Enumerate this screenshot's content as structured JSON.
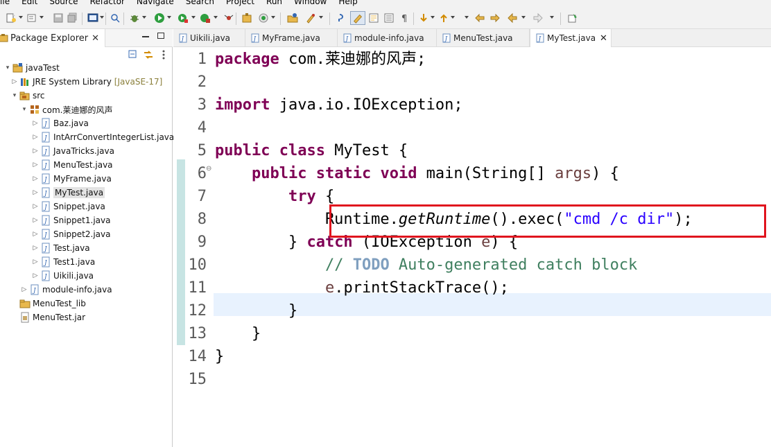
{
  "menubar": {
    "items": [
      "File",
      "Edit",
      "Source",
      "Refactor",
      "Navigate",
      "Search",
      "Project",
      "Run",
      "Window",
      "Help"
    ]
  },
  "package_explorer": {
    "title": "Package Explorer",
    "close_glyph": "✕",
    "tree": [
      {
        "label": "javaTest",
        "icon": "project-icon",
        "depth": 0,
        "twisty": "▾"
      },
      {
        "label": "JRE System Library",
        "decoration": "[JavaSE-17]",
        "icon": "library-icon",
        "depth": 1,
        "twisty": "▷"
      },
      {
        "label": "src",
        "icon": "source-folder-icon",
        "depth": 1,
        "twisty": "▾"
      },
      {
        "label": "com.莱迪娜的风声",
        "icon": "package-icon",
        "depth": 2,
        "twisty": "▾"
      },
      {
        "label": "Baz.java",
        "icon": "java-file-icon",
        "depth": 3,
        "twisty": "▷"
      },
      {
        "label": "IntArrConvertIntegerList.java",
        "icon": "java-file-icon",
        "depth": 3,
        "twisty": "▷"
      },
      {
        "label": "JavaTricks.java",
        "icon": "java-file-icon",
        "depth": 3,
        "twisty": "▷"
      },
      {
        "label": "MenuTest.java",
        "icon": "java-file-icon",
        "depth": 3,
        "twisty": "▷"
      },
      {
        "label": "MyFrame.java",
        "icon": "java-file-icon",
        "depth": 3,
        "twisty": "▷"
      },
      {
        "label": "MyTest.java",
        "icon": "java-file-icon",
        "depth": 3,
        "twisty": "▷",
        "selected": true
      },
      {
        "label": "Snippet.java",
        "icon": "java-file-icon",
        "depth": 3,
        "twisty": "▷"
      },
      {
        "label": "Snippet1.java",
        "icon": "java-file-icon",
        "depth": 3,
        "twisty": "▷"
      },
      {
        "label": "Snippet2.java",
        "icon": "java-file-icon",
        "depth": 3,
        "twisty": "▷"
      },
      {
        "label": "Test.java",
        "icon": "java-file-icon",
        "depth": 3,
        "twisty": "▷"
      },
      {
        "label": "Test1.java",
        "icon": "java-file-icon",
        "depth": 3,
        "twisty": "▷"
      },
      {
        "label": "Uikili.java",
        "icon": "java-file-icon",
        "depth": 3,
        "twisty": "▷"
      },
      {
        "label": "module-info.java",
        "icon": "java-file-icon",
        "depth": 2,
        "twisty": "▷"
      },
      {
        "label": "MenuTest_lib",
        "icon": "folder-icon",
        "depth": 1,
        "twisty": ""
      },
      {
        "label": "MenuTest.jar",
        "icon": "jar-file-icon",
        "depth": 1,
        "twisty": ""
      }
    ]
  },
  "editor": {
    "tabs": [
      {
        "label": "Uikili.java",
        "active": false
      },
      {
        "label": "MyFrame.java",
        "active": false
      },
      {
        "label": "module-info.java",
        "active": false
      },
      {
        "label": "MenuTest.java",
        "active": false
      },
      {
        "label": "MyTest.java",
        "active": true
      }
    ],
    "close_glyph": "✕",
    "lines": [
      {
        "n": "1",
        "tokens": [
          {
            "t": "package",
            "c": "kw"
          },
          {
            "t": " com.莱迪娜的风声;",
            "c": ""
          }
        ]
      },
      {
        "n": "2",
        "tokens": []
      },
      {
        "n": "3",
        "tokens": [
          {
            "t": "import",
            "c": "kw"
          },
          {
            "t": " java.io.IOException;",
            "c": ""
          }
        ]
      },
      {
        "n": "4",
        "tokens": []
      },
      {
        "n": "5",
        "tokens": [
          {
            "t": "public",
            "c": "kw"
          },
          {
            "t": " ",
            "c": ""
          },
          {
            "t": "class",
            "c": "kw"
          },
          {
            "t": " MyTest {",
            "c": ""
          }
        ]
      },
      {
        "n": "6",
        "tokens": [
          {
            "t": "    ",
            "c": ""
          },
          {
            "t": "public",
            "c": "kw"
          },
          {
            "t": " ",
            "c": ""
          },
          {
            "t": "static",
            "c": "kw"
          },
          {
            "t": " ",
            "c": ""
          },
          {
            "t": "void",
            "c": "kw"
          },
          {
            "t": " main(String[] ",
            "c": ""
          },
          {
            "t": "args",
            "c": "param"
          },
          {
            "t": ") {",
            "c": ""
          }
        ],
        "fold": "⊖"
      },
      {
        "n": "7",
        "tokens": [
          {
            "t": "        ",
            "c": ""
          },
          {
            "t": "try",
            "c": "kw"
          },
          {
            "t": " {",
            "c": ""
          }
        ]
      },
      {
        "n": "8",
        "tokens": [
          {
            "t": "            Runtime.",
            "c": ""
          },
          {
            "t": "getRuntime",
            "c": "it"
          },
          {
            "t": "().exec(",
            "c": ""
          },
          {
            "t": "\"cmd /c dir\"",
            "c": "str"
          },
          {
            "t": ");",
            "c": ""
          }
        ]
      },
      {
        "n": "9",
        "tokens": [
          {
            "t": "        } ",
            "c": ""
          },
          {
            "t": "catch",
            "c": "kw"
          },
          {
            "t": " (IOException ",
            "c": ""
          },
          {
            "t": "e",
            "c": "param"
          },
          {
            "t": ") {",
            "c": ""
          }
        ]
      },
      {
        "n": "10",
        "tokens": [
          {
            "t": "            ",
            "c": ""
          },
          {
            "t": "// ",
            "c": "cm"
          },
          {
            "t": "TODO",
            "c": "todo"
          },
          {
            "t": " Auto-generated catch block",
            "c": "cm"
          }
        ]
      },
      {
        "n": "11",
        "tokens": [
          {
            "t": "            ",
            "c": ""
          },
          {
            "t": "e",
            "c": "param"
          },
          {
            "t": ".printStackTrace();",
            "c": ""
          }
        ]
      },
      {
        "n": "12",
        "tokens": [
          {
            "t": "        }",
            "c": ""
          }
        ]
      },
      {
        "n": "13",
        "tokens": [
          {
            "t": "    }",
            "c": ""
          }
        ]
      },
      {
        "n": "14",
        "tokens": [
          {
            "t": "}",
            "c": ""
          }
        ]
      },
      {
        "n": "15",
        "tokens": []
      }
    ]
  },
  "colors": {
    "keyword": "#7f0055",
    "string": "#2a00ff",
    "comment": "#3f7f5f",
    "highlight_box": "#e0141e",
    "current_line": "#e8f2fe"
  }
}
